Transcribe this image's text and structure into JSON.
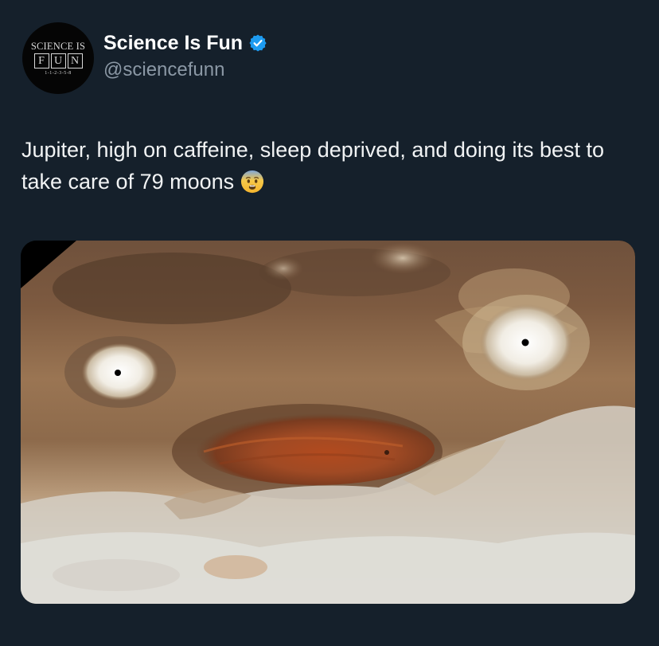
{
  "account": {
    "display_name": "Science Is Fun",
    "handle": "@sciencefunn",
    "verified": true,
    "avatar_logo": {
      "line1": "SCIENCE IS",
      "letters": [
        "F",
        "U",
        "N"
      ],
      "line3": "1-1-2-3-5-8"
    }
  },
  "tweet": {
    "text": "Jupiter, high on caffeine, sleep deprived, and doing its best to take care of 79 moons",
    "emoji": "fearful-face-emoji"
  },
  "media": {
    "subject": "jupiter-face-photo"
  },
  "colors": {
    "background": "#15202b",
    "verified_blue": "#1d9bf0",
    "secondary_text": "#8b98a5"
  }
}
